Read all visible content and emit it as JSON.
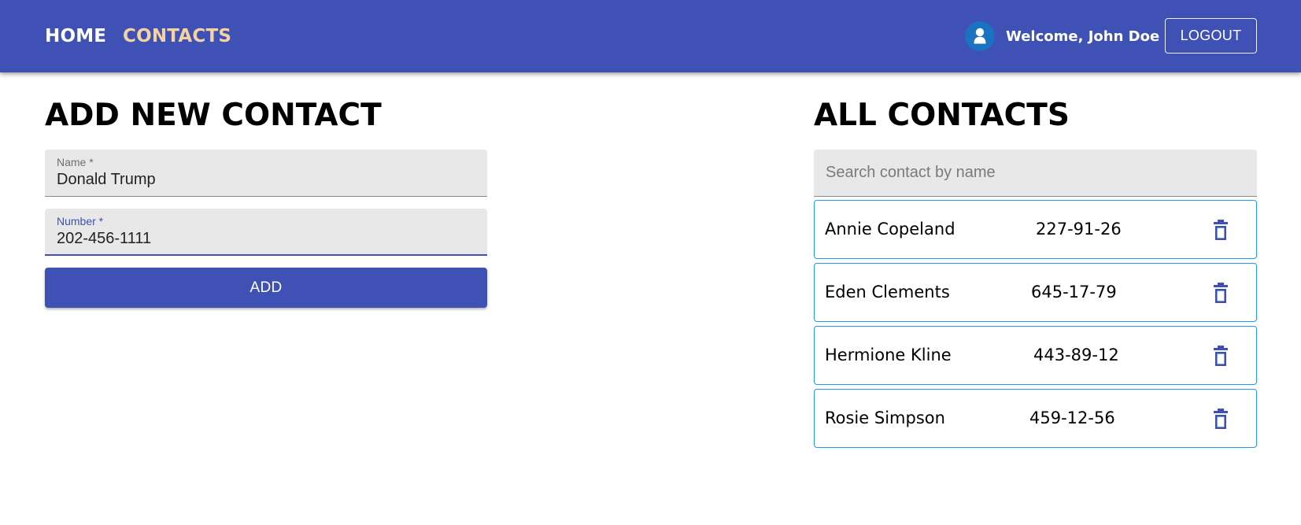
{
  "header": {
    "nav": [
      {
        "label": "HOME",
        "active": false
      },
      {
        "label": "CONTACTS",
        "active": true
      }
    ],
    "welcome": "Welcome, John Doe",
    "logout_label": "LOGOUT",
    "avatar_icon": "user-avatar-icon"
  },
  "add_form": {
    "title": "ADD NEW CONTACT",
    "name_label": "Name *",
    "name_value": "Donald Trump",
    "number_label": "Number *",
    "number_value": "202-456-1111",
    "submit_label": "ADD"
  },
  "contacts_panel": {
    "title": "ALL CONTACTS",
    "search_placeholder": "Search contact by name",
    "search_value": "",
    "contacts": [
      {
        "name": "Annie Copeland",
        "number": "227-91-26"
      },
      {
        "name": "Eden Clements",
        "number": "645-17-79"
      },
      {
        "name": "Hermione Kline",
        "number": "443-89-12"
      },
      {
        "name": "Rosie Simpson",
        "number": "459-12-56"
      }
    ],
    "delete_icon": "trash-icon"
  },
  "colors": {
    "primary": "#3f51b5",
    "active_nav": "#f5d3a0",
    "card_border": "#2196f3",
    "avatar_bg": "#1a72c0"
  }
}
